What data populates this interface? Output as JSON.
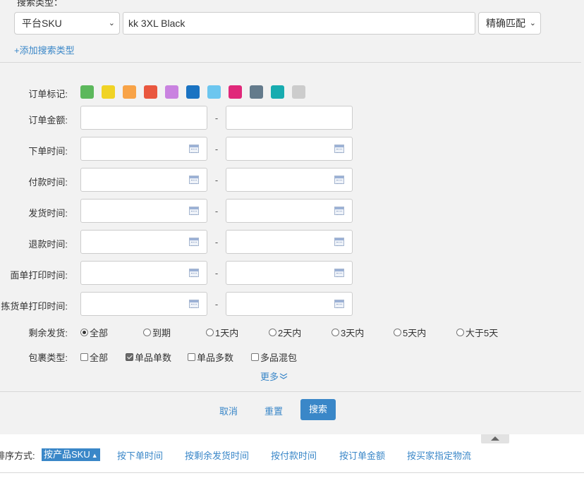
{
  "search_type": {
    "label": "搜索类型：",
    "field_select": "平台SKU",
    "query_value": "kk 3XL Black",
    "match_select": "精确匹配",
    "add_type_link": "+添加搜索类型"
  },
  "order_mark": {
    "label": "订单标记:",
    "colors": [
      "#5cb85c",
      "#f0d325",
      "#f8a347",
      "#e9573f",
      "#c982e0",
      "#1a73c2",
      "#6cc6ef",
      "#e0287a",
      "#647b8c",
      "#18acb0",
      "#cccccc"
    ]
  },
  "order_amount": {
    "label": "订单金额:",
    "separator": "-"
  },
  "date_filters": [
    {
      "label": "下单时间:",
      "separator": "-"
    },
    {
      "label": "付款时间:",
      "separator": "-"
    },
    {
      "label": "发货时间:",
      "separator": "-"
    },
    {
      "label": "退款时间:",
      "separator": "-"
    },
    {
      "label": "面单打印时间:",
      "separator": "-"
    },
    {
      "label": "拣货单打印时间:",
      "separator": "-"
    }
  ],
  "remaining_ship": {
    "label": "剩余发货:",
    "options": [
      "全部",
      "到期",
      "1天内",
      "2天内",
      "3天内",
      "5天内",
      "大于5天"
    ],
    "selected": "全部"
  },
  "package_type": {
    "label": "包裹类型:",
    "options": [
      "全部",
      "单品单数",
      "单品多数",
      "多品混包"
    ],
    "checked": [
      "单品单数"
    ]
  },
  "more_link": "更多",
  "actions": {
    "cancel": "取消",
    "reset": "重置",
    "search": "搜索"
  },
  "sort": {
    "label": "排序方式:",
    "active": "按产品SKU",
    "items": [
      "按下单时间",
      "按剩余发货时间",
      "按付款时间",
      "按订单金额",
      "按买家指定物流"
    ]
  }
}
